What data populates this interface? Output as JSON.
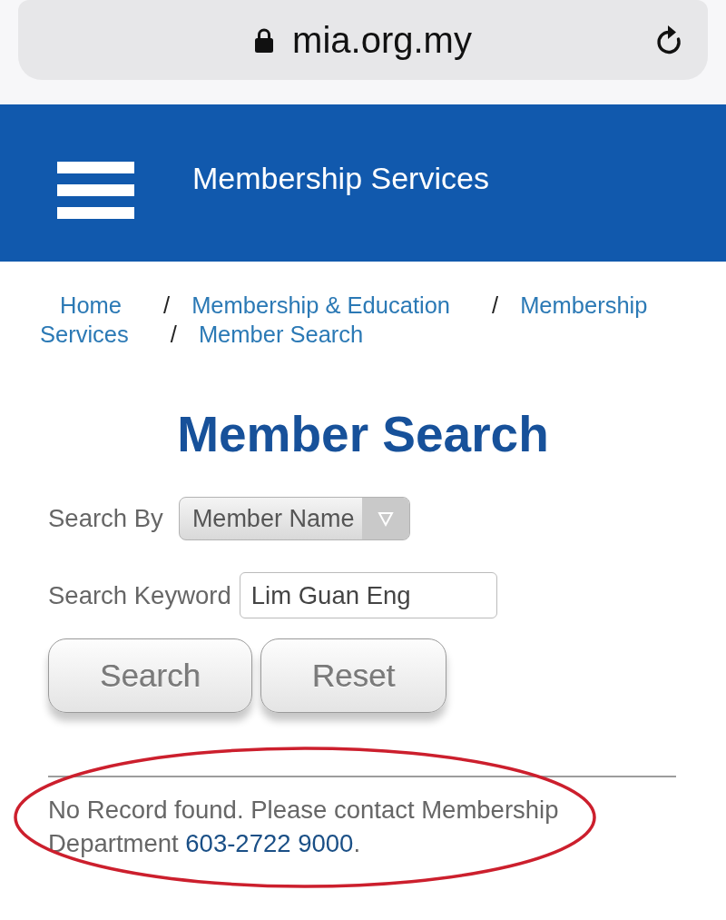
{
  "address_bar": {
    "url": "mia.org.my",
    "secure": true
  },
  "header": {
    "title": "Membership Services"
  },
  "breadcrumb": [
    {
      "kind": "link",
      "lines": [
        "Home"
      ]
    },
    {
      "kind": "separator",
      "text": "/"
    },
    {
      "kind": "link",
      "lines": [
        "Membership & Education"
      ]
    },
    {
      "kind": "separator",
      "text": "/"
    },
    {
      "kind": "link",
      "lines": [
        "Membership",
        "Services"
      ]
    },
    {
      "kind": "separator",
      "text": "/"
    },
    {
      "kind": "link",
      "lines": [
        "Member Search"
      ]
    }
  ],
  "page_title": "Member Search",
  "form": {
    "search_by": {
      "label": "Search By",
      "value": "Member Name"
    },
    "keyword": {
      "label": "Search Keyword",
      "value": "Lim Guan Eng"
    },
    "buttons": [
      {
        "kind": "submit",
        "label": "Search"
      },
      {
        "kind": "reset",
        "label": "Reset"
      }
    ]
  },
  "result": {
    "text": "No Record found. Please contact Membership Department ",
    "phone": "603-2722 9000",
    "after": "."
  }
}
